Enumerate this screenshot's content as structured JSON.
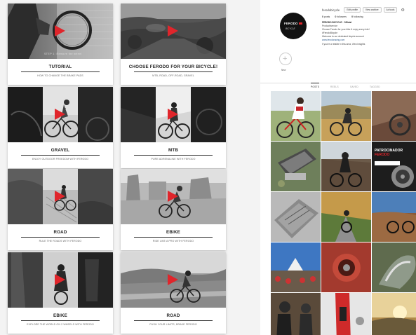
{
  "cards": [
    {
      "title": "TUTORIAL",
      "subtitle": "HOW TO CHANGE THE BRAKE PADS",
      "overlay": "STEP 1: Remove the wheel"
    },
    {
      "title": "CHOOSE FERODO FOR YOUR BICYCLE!",
      "subtitle": "MTB, ROAD, OFF-ROAD, GRAVEL",
      "overlay": ""
    },
    {
      "title": "GRAVEL",
      "subtitle": "ENJOY OUTDOOR FREEDOM WITH FERODO",
      "overlay": ""
    },
    {
      "title": "MTB",
      "subtitle": "PURE ADRENALINE WITH FERODO",
      "overlay": ""
    },
    {
      "title": "ROAD",
      "subtitle": "RULE THE ROADS WITH FERODO",
      "overlay": ""
    },
    {
      "title": "EBIKE",
      "subtitle": "RIDE LIKE A PRO WITH FERODO",
      "overlay": ""
    },
    {
      "title": "EBIKE",
      "subtitle": "EXPLORE THE WORLD ON 2 WHEELS WITH FERODO",
      "overlay": ""
    },
    {
      "title": "ROAD",
      "subtitle": "PUSH YOUR LIMITS, BRAKE FERODO",
      "overlay": ""
    }
  ],
  "profile": {
    "username": "ferodobicycle",
    "buttons": [
      "Edit profile",
      "View archive",
      "Ad tools"
    ],
    "stats": [
      {
        "count": "0",
        "label": "posts"
      },
      {
        "count": "0",
        "label": "followers"
      },
      {
        "count": "0",
        "label": "following"
      }
    ],
    "bio": {
      "name": "FERODO BICYCLE · Official",
      "category": "Product/service",
      "lines": [
        "Choose Ferodo for your bike & enjoy every ride!",
        "#FerodoBicycle",
        "Welcome to our dedicated bicycle account"
      ],
      "link": "www.ferodoracing.com",
      "note": "If you're a retailer in this area, View insights"
    },
    "logo": {
      "brand": "FERODO",
      "tagline": "BICYCLE"
    },
    "highlight_label": "New"
  },
  "tabs": [
    "POSTS",
    "REELS",
    "SAVED",
    "TAGGED"
  ],
  "feed_tiles": [
    {
      "text": "",
      "accent": ""
    },
    {
      "text": "",
      "accent": ""
    },
    {
      "text": "",
      "accent": ""
    },
    {
      "text": "",
      "accent": ""
    },
    {
      "text": "",
      "accent": ""
    },
    {
      "text": "PATROCINADOR",
      "accent": "FERODO"
    },
    {
      "text": "",
      "accent": ""
    },
    {
      "text": "",
      "accent": ""
    },
    {
      "text": "",
      "accent": ""
    },
    {
      "text": "",
      "accent": ""
    },
    {
      "text": "",
      "accent": ""
    },
    {
      "text": "",
      "accent": ""
    },
    {
      "text": "",
      "accent": ""
    },
    {
      "text": "",
      "accent": ""
    },
    {
      "text": "",
      "accent": ""
    }
  ],
  "colors": {
    "play": "#e0252b",
    "brand_red": "#e0252b"
  }
}
